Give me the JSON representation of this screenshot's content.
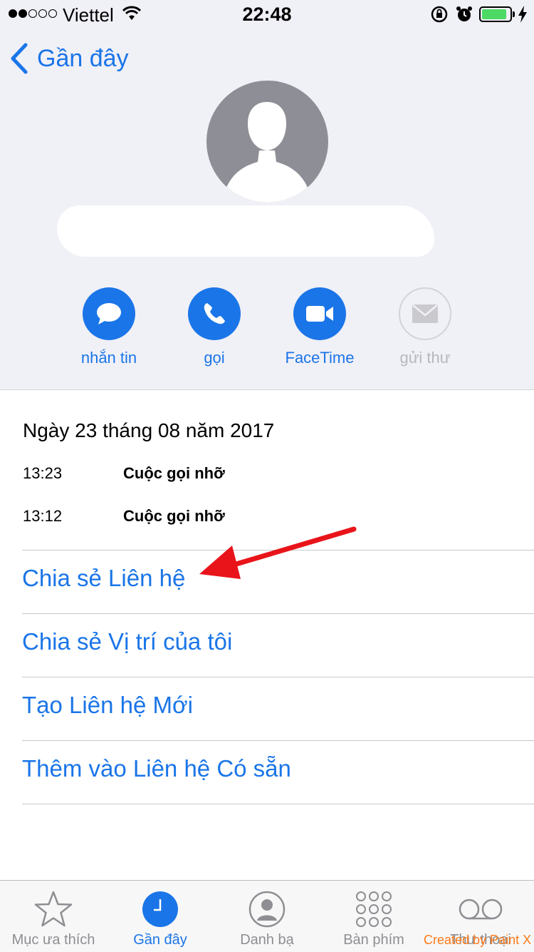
{
  "status_bar": {
    "carrier": "Viettel",
    "time": "22:48"
  },
  "nav": {
    "back_label": "Gần đây"
  },
  "actions": [
    {
      "label": "nhắn tin",
      "icon": "message-icon",
      "enabled": true
    },
    {
      "label": "gọi",
      "icon": "phone-icon",
      "enabled": true
    },
    {
      "label": "FaceTime",
      "icon": "video-icon",
      "enabled": true
    },
    {
      "label": "gửi thư",
      "icon": "mail-icon",
      "enabled": false
    }
  ],
  "call_log": {
    "date": "Ngày 23 tháng 08 năm 2017",
    "calls": [
      {
        "time": "13:23",
        "type": "Cuộc gọi nhỡ"
      },
      {
        "time": "13:12",
        "type": "Cuộc gọi nhỡ"
      }
    ]
  },
  "options": [
    {
      "label": "Chia sẻ Liên hệ"
    },
    {
      "label": "Chia sẻ Vị trí của tôi"
    },
    {
      "label": "Tạo Liên hệ Mới"
    },
    {
      "label": "Thêm vào Liên hệ Có sẵn"
    }
  ],
  "tabbar": {
    "tabs": [
      {
        "label": "Mục ưa thích",
        "icon": "star-icon",
        "active": false
      },
      {
        "label": "Gần đây",
        "icon": "clock-icon",
        "active": true
      },
      {
        "label": "Danh bạ",
        "icon": "contacts-icon",
        "active": false
      },
      {
        "label": "Bàn phím",
        "icon": "keypad-icon",
        "active": false
      },
      {
        "label": "Thư thoại",
        "icon": "voicemail-icon",
        "active": false
      }
    ]
  },
  "watermark": "Created by Paint X",
  "colors": {
    "accent": "#1a75e8",
    "header_bg": "#f0f0f7",
    "annotation_arrow": "#e8141a",
    "battery": "#4cd964"
  }
}
